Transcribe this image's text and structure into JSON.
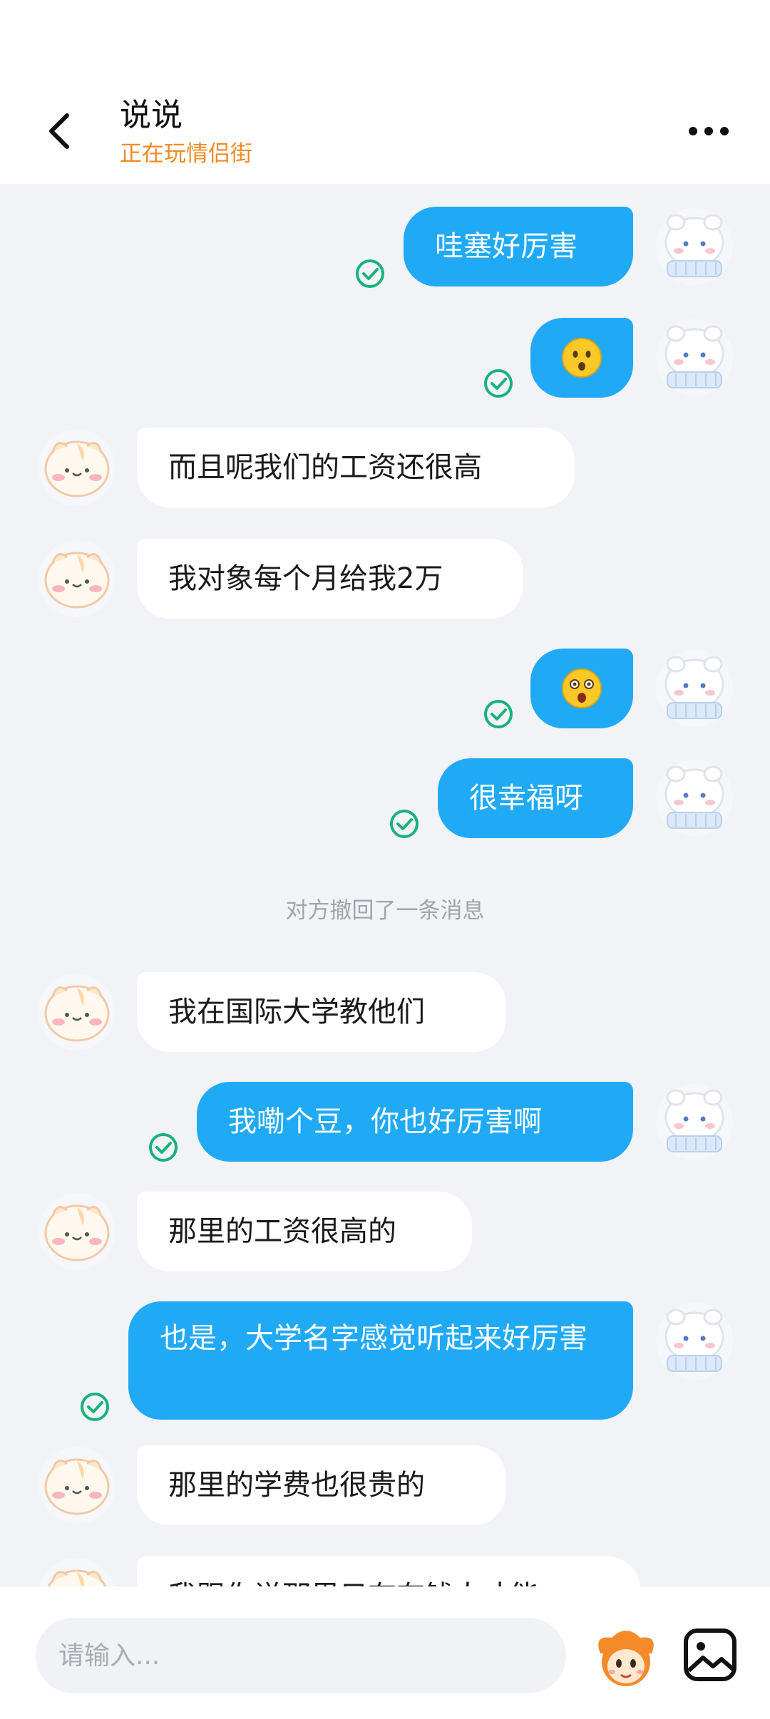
{
  "header": {
    "title": "说说",
    "subtitle": "正在玩情侣街"
  },
  "messages": [
    {
      "dir": "out",
      "text": "哇塞好厉害"
    },
    {
      "dir": "out",
      "emoji": "hushed-face"
    },
    {
      "dir": "in",
      "text": "而且呢我们的工资还很高"
    },
    {
      "dir": "in",
      "text": "我对象每个月给我2万"
    },
    {
      "dir": "out",
      "emoji": "astonished-face"
    },
    {
      "dir": "out",
      "text": "很幸福呀"
    },
    {
      "dir": "system",
      "text": "对方撤回了一条消息"
    },
    {
      "dir": "in",
      "text": "我在国际大学教他们"
    },
    {
      "dir": "out",
      "text": "我嘞个豆，你也好厉害啊"
    },
    {
      "dir": "in",
      "text": "那里的工资很高的"
    },
    {
      "dir": "out",
      "text": "也是，大学名字感觉听起来好厉害"
    },
    {
      "dir": "in",
      "text": "那里的学费也很贵的"
    },
    {
      "dir": "in",
      "text": "我跟你说那里只有有钱人才能"
    }
  ],
  "input": {
    "placeholder": "请输入..."
  },
  "colors": {
    "sent_bubble": "#20aaf6",
    "received_bubble": "#ffffff",
    "subtitle": "#f08a24",
    "read_tick": "#18b27a"
  }
}
